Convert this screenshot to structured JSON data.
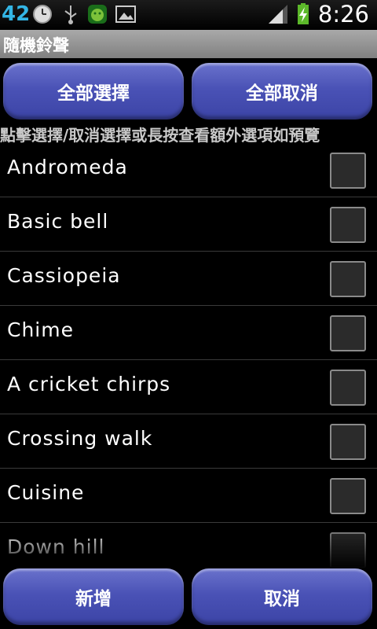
{
  "status_bar": {
    "notification_count": "42",
    "time": "8:26",
    "icons": [
      "clock-icon",
      "usb-icon",
      "android-icon",
      "gallery-icon",
      "signal-icon",
      "battery-charging-icon"
    ]
  },
  "title": "隨機鈴聲",
  "buttons": {
    "select_all": "全部選擇",
    "deselect_all": "全部取消",
    "add": "新增",
    "cancel": "取消"
  },
  "hint": "點擊選擇/取消選擇或長按查看額外選項如預覽",
  "ringtones": [
    {
      "label": "Andromeda",
      "checked": false
    },
    {
      "label": "Basic bell",
      "checked": false
    },
    {
      "label": "Cassiopeia",
      "checked": false
    },
    {
      "label": "Chime",
      "checked": false
    },
    {
      "label": "A cricket chirps",
      "checked": false
    },
    {
      "label": "Crossing walk",
      "checked": false
    },
    {
      "label": "Cuisine",
      "checked": false
    },
    {
      "label": "Down hill",
      "checked": false
    }
  ],
  "colors": {
    "accent_blue": "#4a52b6",
    "status_blue": "#33b5e5",
    "title_gray": "#909090"
  }
}
